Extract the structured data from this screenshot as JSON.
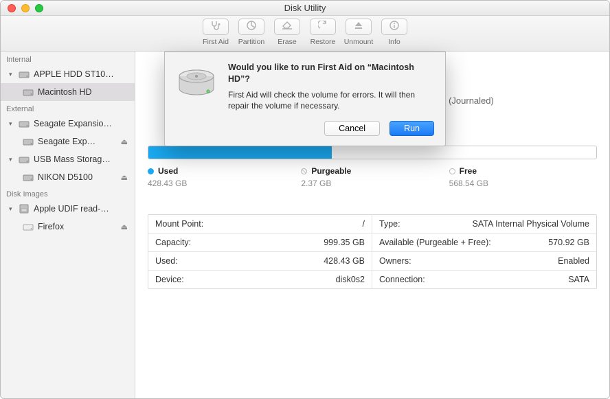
{
  "window": {
    "title": "Disk Utility"
  },
  "toolbar": {
    "firstAid": "First Aid",
    "partition": "Partition",
    "erase": "Erase",
    "restore": "Restore",
    "unmount": "Unmount",
    "info": "Info"
  },
  "sidebar": {
    "sections": {
      "internal": "Internal",
      "external": "External",
      "diskImages": "Disk Images"
    },
    "internalDisk": "APPLE HDD ST10…",
    "internalVol": "Macintosh HD",
    "external1": "Seagate Expansio…",
    "external1Vol": "Seagate Exp…",
    "external2": "USB Mass Storag…",
    "external2Vol": "NIKON D5100",
    "image1": "Apple UDIF read-…",
    "image1Vol": "Firefox",
    "eject": "⏏"
  },
  "main": {
    "fsHint": "ed (Journaled)",
    "legend": {
      "usedTitle": "Used",
      "usedValue": "428.43 GB",
      "purgeTitle": "Purgeable",
      "purgeValue": "2.37 GB",
      "freeTitle": "Free",
      "freeValue": "568.54 GB"
    },
    "table": {
      "mountPointK": "Mount Point:",
      "mountPointV": "/",
      "typeK": "Type:",
      "typeV": "SATA Internal Physical Volume",
      "capacityK": "Capacity:",
      "capacityV": "999.35 GB",
      "availK": "Available (Purgeable + Free):",
      "availV": "570.92 GB",
      "usedK": "Used:",
      "usedV": "428.43 GB",
      "ownersK": "Owners:",
      "ownersV": "Enabled",
      "deviceK": "Device:",
      "deviceV": "disk0s2",
      "connK": "Connection:",
      "connV": "SATA"
    }
  },
  "dialog": {
    "heading": "Would you like to run First Aid on “Macintosh HD”?",
    "body": "First Aid will check the volume for errors. It will then repair the volume if necessary.",
    "cancel": "Cancel",
    "run": "Run"
  }
}
